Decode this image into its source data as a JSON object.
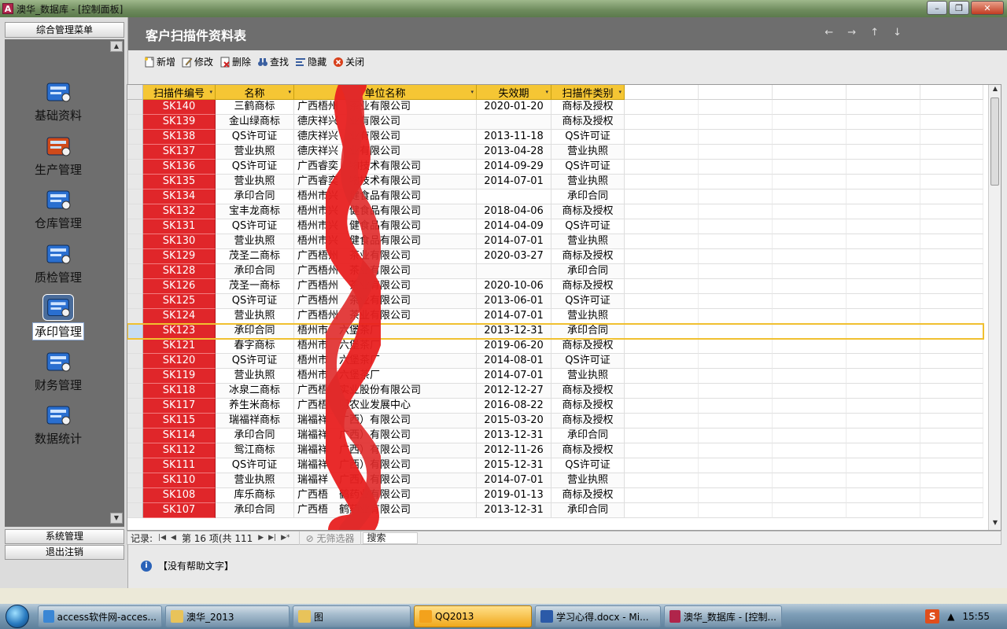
{
  "window": {
    "app_icon": "A",
    "title": "澳华_数据库 - [控制面板]",
    "min": "–",
    "max": "❐",
    "close": "✕"
  },
  "left": {
    "header": "综合管理菜单",
    "items": [
      {
        "label": "基础资料",
        "icon": "abc-book-icon"
      },
      {
        "label": "生产管理",
        "icon": "production-gear-icon"
      },
      {
        "label": "仓库管理",
        "icon": "warehouse-books-icon"
      },
      {
        "label": "质检管理",
        "icon": "inspection-gauge-icon"
      },
      {
        "label": "承印管理",
        "icon": "print-document-icon"
      },
      {
        "label": "财务管理",
        "icon": "finance-money-icon"
      },
      {
        "label": "数据统计",
        "icon": "statistics-chart-icon"
      }
    ],
    "active_index": 4,
    "system": "系统管理",
    "logout": "退出注销"
  },
  "form": {
    "title": "客户扫描件资料表",
    "nav_arrows": [
      "←",
      "→",
      "↑",
      "↓"
    ],
    "toolbar": [
      "新增",
      "修改",
      "删除",
      "查找",
      "隐藏",
      "关闭"
    ]
  },
  "grid": {
    "columns": [
      "扫描件编号",
      "名称",
      "单位名称",
      "失效期",
      "扫描件类别"
    ],
    "rows": [
      [
        "SK140",
        "三鹤商标",
        "广西梧州",
        "茶业有限公司",
        "2020-01-20",
        "商标及授权"
      ],
      [
        "SK139",
        "金山绿商标",
        "德庆祥兴",
        "业有限公司",
        "",
        "商标及授权"
      ],
      [
        "SK138",
        "QS许可证",
        "德庆祥兴",
        "业有限公司",
        "2013-11-18",
        "QS许可证"
      ],
      [
        "SK137",
        "营业执照",
        "德庆祥兴",
        "业有限公司",
        "2013-04-28",
        "营业执照"
      ],
      [
        "SK136",
        "QS许可证",
        "广西睿奕",
        "物技术有限公司",
        "2014-09-29",
        "QS许可证"
      ],
      [
        "SK135",
        "营业执照",
        "广西睿奕",
        "物技术有限公司",
        "2014-07-01",
        "营业执照"
      ],
      [
        "SK134",
        "承印合同",
        "梧州市兴",
        "健食品有限公司",
        "",
        "承印合同"
      ],
      [
        "SK132",
        "宝丰龙商标",
        "梧州市兴",
        "健食品有限公司",
        "2018-04-06",
        "商标及授权"
      ],
      [
        "SK131",
        "QS许可证",
        "梧州市兴",
        "健食品有限公司",
        "2014-04-09",
        "QS许可证"
      ],
      [
        "SK130",
        "营业执照",
        "梧州市兴",
        "健食品有限公司",
        "2014-07-01",
        "营业执照"
      ],
      [
        "SK129",
        "茂圣二商标",
        "广西梧州",
        "茶业有限公司",
        "2020-03-27",
        "商标及授权"
      ],
      [
        "SK128",
        "承印合同",
        "广西梧州",
        "茶业有限公司",
        "",
        "承印合同"
      ],
      [
        "SK126",
        "茂圣一商标",
        "广西梧州",
        "茶业有限公司",
        "2020-10-06",
        "商标及授权"
      ],
      [
        "SK125",
        "QS许可证",
        "广西梧州",
        "茶业有限公司",
        "2013-06-01",
        "QS许可证"
      ],
      [
        "SK124",
        "营业执照",
        "广西梧州",
        "茶业有限公司",
        "2014-07-01",
        "营业执照"
      ],
      [
        "SK123",
        "承印合同",
        "梧州市",
        "六堡茶厂",
        "2013-12-31",
        "承印合同"
      ],
      [
        "SK121",
        "春字商标",
        "梧州市",
        "六堡茶厂",
        "2019-06-20",
        "商标及授权"
      ],
      [
        "SK120",
        "QS许可证",
        "梧州市",
        "六堡茶厂",
        "2014-08-01",
        "QS许可证"
      ],
      [
        "SK119",
        "营业执照",
        "梧州市",
        "六堡茶厂",
        "2014-07-01",
        "营业执照"
      ],
      [
        "SK118",
        "冰泉二商标",
        "广西梧",
        "实业股份有限公司",
        "2012-12-27",
        "商标及授权"
      ],
      [
        "SK117",
        "养生米商标",
        "广西梧",
        "明农业发展中心",
        "2016-08-22",
        "商标及授权"
      ],
      [
        "SK115",
        "瑞福祥商标",
        "瑞福祥",
        "广西）有限公司",
        "2015-03-20",
        "商标及授权"
      ],
      [
        "SK114",
        "承印合同",
        "瑞福祥",
        "广西）有限公司",
        "2013-12-31",
        "承印合同"
      ],
      [
        "SK112",
        "鸳江商标",
        "瑞福祥",
        "广西）有限公司",
        "2012-11-26",
        "商标及授权"
      ],
      [
        "SK111",
        "QS许可证",
        "瑞福祥",
        "广西）有限公司",
        "2015-12-31",
        "QS许可证"
      ],
      [
        "SK110",
        "营业执照",
        "瑞福祥",
        "广西）有限公司",
        "2014-07-01",
        "营业执照"
      ],
      [
        "SK108",
        "库乐商标",
        "广西梧",
        "鹤药业有限公司",
        "2019-01-13",
        "商标及授权"
      ],
      [
        "SK107",
        "承印合同",
        "广西梧",
        "鹤药业有限公司",
        "2013-12-31",
        "承印合同"
      ]
    ],
    "current_row": 15
  },
  "recnav": {
    "label": "记录:",
    "position": "第 16 项(共 111",
    "filter": "无筛选器",
    "search": "搜索"
  },
  "help": {
    "text": "【没有帮助文字】"
  },
  "taskbar": {
    "tasks": [
      {
        "label": "access软件网-acces...",
        "color": "#3a86d4"
      },
      {
        "label": "澳华_2013",
        "color": "#e8c35a"
      },
      {
        "label": "图",
        "color": "#e8c35a"
      },
      {
        "label": "QQ2013",
        "color": "#f3a21c"
      },
      {
        "label": "学习心得.docx - Mi...",
        "color": "#2b5aa8"
      },
      {
        "label": "澳华_数据库 - [控制...",
        "color": "#b0254b"
      }
    ],
    "active_task": 3,
    "tray_icon": "S",
    "tray_arrow": "▲",
    "time": "15:55"
  },
  "colors": {
    "code_cell": "#e0262a",
    "header": "#f5c634",
    "form_header": "#6e6e6e"
  }
}
